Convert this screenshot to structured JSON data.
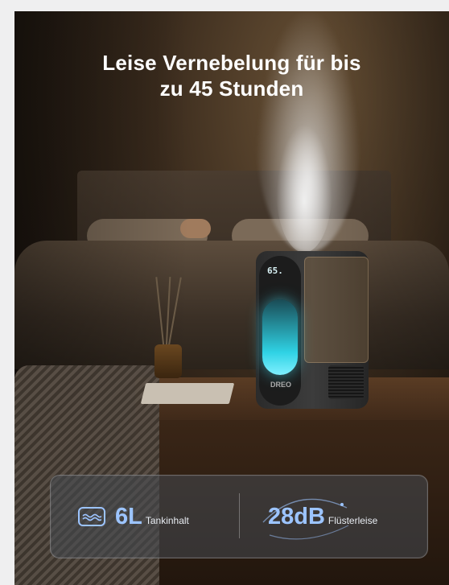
{
  "hero": {
    "title_line1": "Leise Vernebelung für bis",
    "title_line2": "zu 45 Stunden"
  },
  "device": {
    "display_reading": "65.",
    "brand": "DREO"
  },
  "features": {
    "capacity": {
      "value": "6L",
      "label": "Tankinhalt",
      "icon": "water-tank-icon"
    },
    "noise": {
      "value": "28dB",
      "label": "Flüsterleise",
      "icon": "sound-wave-icon"
    }
  },
  "colors": {
    "accent": "#9cc4ff",
    "glow": "#2fd2e4"
  }
}
